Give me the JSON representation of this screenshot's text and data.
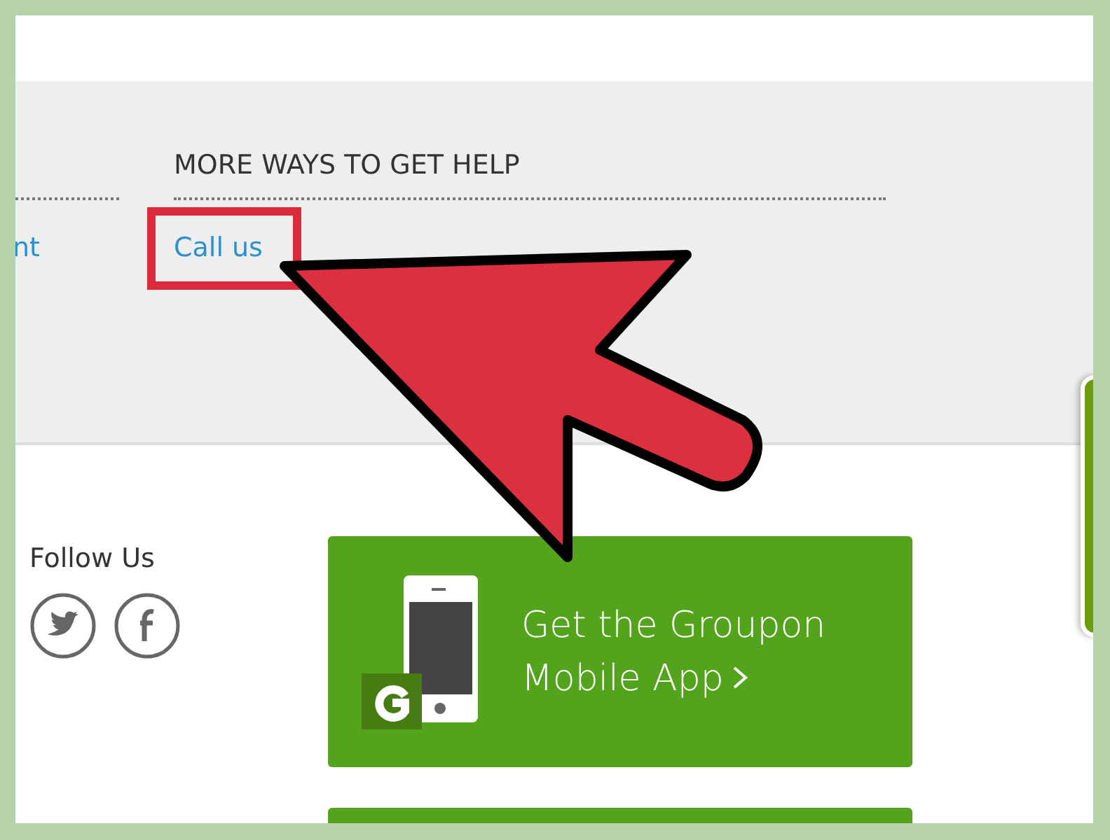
{
  "help_section": {
    "heading": "MORE WAYS TO GET HELP",
    "links": [
      {
        "text": "nt",
        "highlighted": false
      },
      {
        "text": "Call us",
        "highlighted": true
      }
    ]
  },
  "follow": {
    "title": "Follow Us",
    "networks": [
      {
        "kind": "twitter"
      },
      {
        "kind": "facebook"
      }
    ]
  },
  "app_banner": {
    "text": "Get the Groupon Mobile App"
  },
  "pointer_arrow": true
}
